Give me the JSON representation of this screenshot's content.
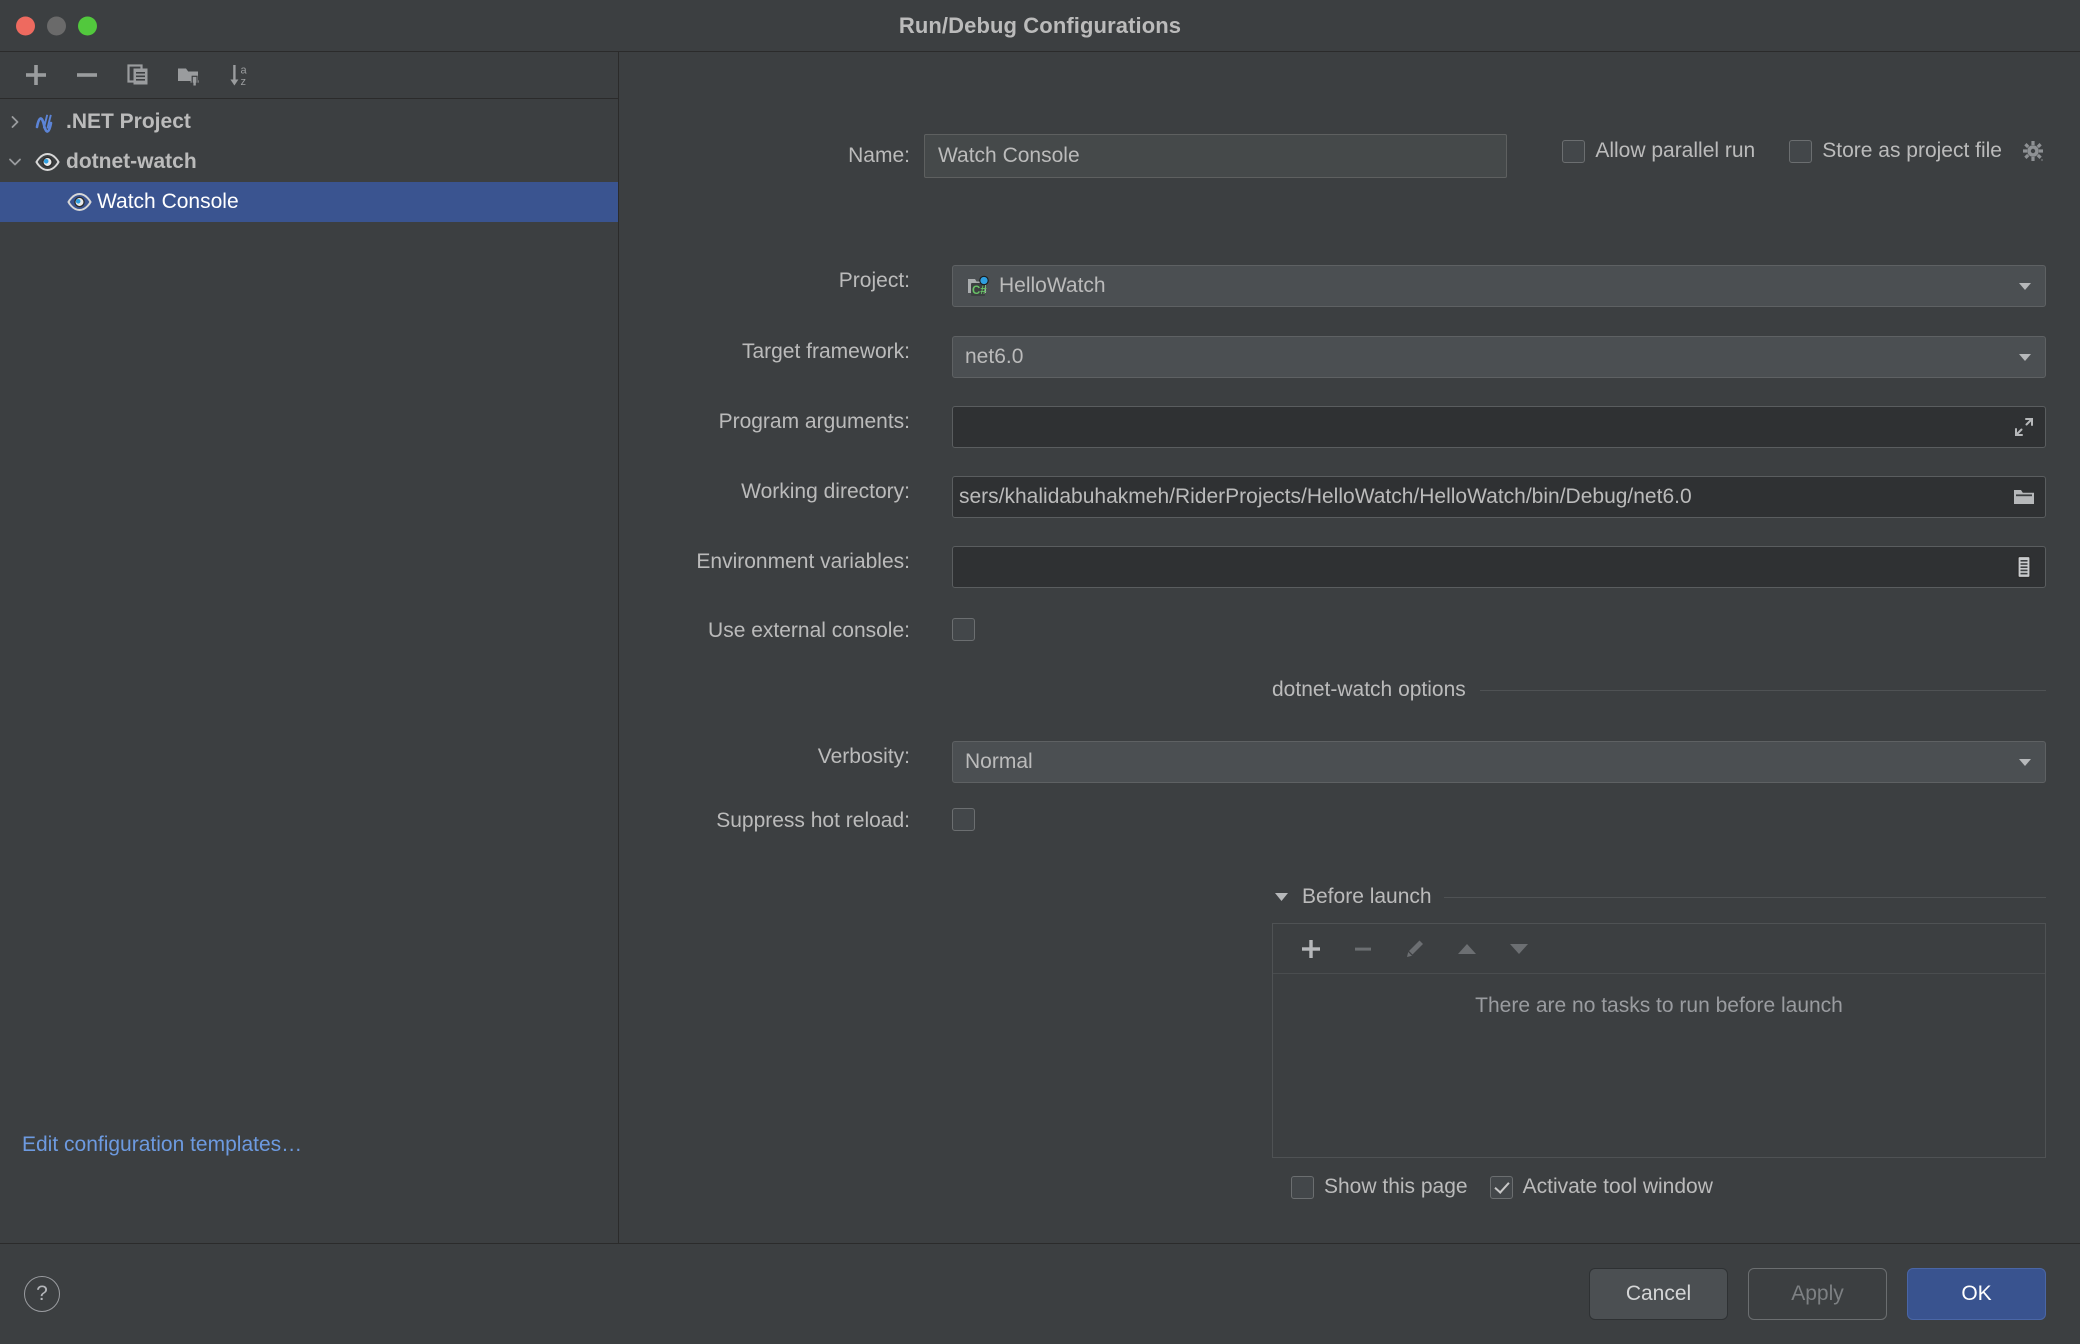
{
  "window": {
    "title": "Run/Debug Configurations",
    "traffic_lights": [
      "close",
      "minimize",
      "zoom"
    ]
  },
  "sidebar": {
    "toolbar": [
      {
        "name": "add-configuration-button",
        "icon": "plus-icon"
      },
      {
        "name": "remove-configuration-button",
        "icon": "minus-icon"
      },
      {
        "name": "copy-configuration-button",
        "icon": "copy-icon"
      },
      {
        "name": "new-folder-button",
        "icon": "new-folder-icon"
      },
      {
        "name": "sort-configurations-button",
        "icon": "sort-az-icon"
      }
    ],
    "tree": [
      {
        "label": ".NET Project",
        "icon": "dotnet-icon",
        "expanded": false,
        "level": 0,
        "selected": false
      },
      {
        "label": "dotnet-watch",
        "icon": "watch-eye-icon",
        "expanded": true,
        "level": 0,
        "selected": false
      },
      {
        "label": "Watch Console",
        "icon": "watch-eye-icon",
        "level": 1,
        "selected": true
      }
    ],
    "edit_templates_link": "Edit configuration templates…"
  },
  "main": {
    "name_label": "Name:",
    "name_value": "Watch Console",
    "allow_parallel_run": {
      "label": "Allow parallel run",
      "checked": false
    },
    "store_as_project_file": {
      "label": "Store as project file",
      "checked": false
    },
    "fields": {
      "project_label": "Project:",
      "project_value": "HelloWatch",
      "project_icon": "csharp-project-icon",
      "target_framework_label": "Target framework:",
      "target_framework_value": "net6.0",
      "program_arguments_label": "Program arguments:",
      "program_arguments_value": "",
      "working_directory_label": "Working directory:",
      "working_directory_value": "sers/khalidabuhakmeh/RiderProjects/HelloWatch/HelloWatch/bin/Debug/net6.0",
      "environment_variables_label": "Environment variables:",
      "environment_variables_value": "",
      "use_external_console_label": "Use external console:",
      "use_external_console_checked": false
    },
    "watch_options": {
      "section_title": "dotnet-watch options",
      "verbosity_label": "Verbosity:",
      "verbosity_value": "Normal",
      "suppress_hot_reload_label": "Suppress hot reload:",
      "suppress_hot_reload_checked": false
    },
    "before_launch": {
      "title": "Before launch",
      "expanded": true,
      "toolbar": [
        {
          "name": "add-task-button",
          "icon": "plus-icon",
          "enabled": true
        },
        {
          "name": "remove-task-button",
          "icon": "minus-icon",
          "enabled": false
        },
        {
          "name": "edit-task-button",
          "icon": "pencil-icon",
          "enabled": false
        },
        {
          "name": "move-task-up-button",
          "icon": "triangle-up-icon",
          "enabled": false
        },
        {
          "name": "move-task-down-button",
          "icon": "triangle-down-icon",
          "enabled": false
        }
      ],
      "empty_text": "There are no tasks to run before launch",
      "show_this_page": {
        "label": "Show this page",
        "checked": false
      },
      "activate_tool_window": {
        "label": "Activate tool window",
        "checked": true
      }
    }
  },
  "footer": {
    "help_label": "?",
    "cancel_label": "Cancel",
    "apply_label": "Apply",
    "ok_label": "OK"
  },
  "colors": {
    "background": "#3c3f41",
    "selection_blue": "#3a5490",
    "accent_button": "#39538f",
    "link_blue": "#6d9ae0",
    "text": "#bbbbbb",
    "csharp_green": "#68c266"
  }
}
